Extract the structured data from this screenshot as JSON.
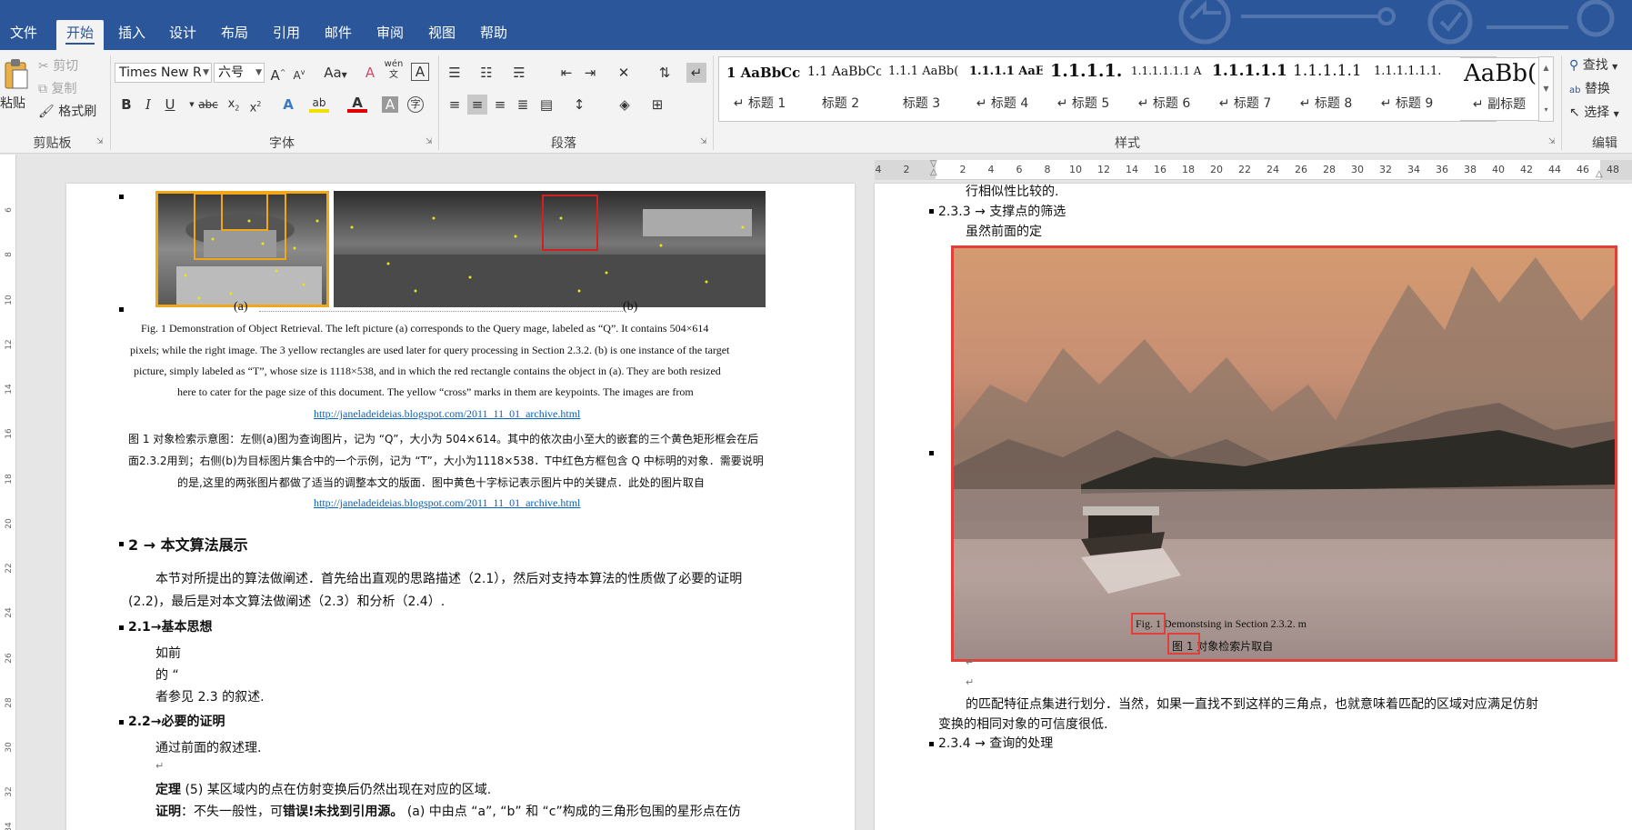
{
  "app": {
    "accent": "#2b579a",
    "tabs": [
      "文件",
      "开始",
      "插入",
      "设计",
      "布局",
      "引用",
      "邮件",
      "审阅",
      "视图",
      "帮助"
    ],
    "active_tab": "开始"
  },
  "ribbon": {
    "clipboard": {
      "label": "剪贴板",
      "paste": "粘贴",
      "cut": "剪切",
      "copy": "复制",
      "format_painter": "格式刷"
    },
    "font": {
      "label": "字体",
      "font_name": "Times New R",
      "font_size": "六号",
      "change_case": "Aa",
      "phonetic": "wén"
    },
    "paragraph": {
      "label": "段落"
    },
    "styles": {
      "label": "样式",
      "items": [
        {
          "sample": "1  AaBbCc",
          "name": "↵ 标题 1"
        },
        {
          "sample": "1.1  AaBbCc",
          "name": "标题 2"
        },
        {
          "sample": "1.1.1  AaBb(",
          "name": "标题 3"
        },
        {
          "sample": "1.1.1.1  AaE",
          "name": "↵ 标题 4"
        },
        {
          "sample": "1.1.1.1.",
          "name": "↵ 标题 5"
        },
        {
          "sample": "1.1.1.1.1.1  A",
          "name": "↵ 标题 6"
        },
        {
          "sample": "1.1.1.1.1.",
          "name": "↵ 标题 7"
        },
        {
          "sample": "1.1.1.1.1",
          "name": "↵ 标题 8"
        },
        {
          "sample": "1.1.1.1.1.1.",
          "name": "↵ 标题 9"
        },
        {
          "sample": "AaBb(",
          "name": "↵ 副标题"
        }
      ]
    },
    "editing": {
      "label": "编辑",
      "find": "查找",
      "replace": "替换",
      "select": "选择"
    }
  },
  "rulers": {
    "vertical_ticks": [
      "6",
      "8",
      "10",
      "12",
      "14",
      "16",
      "18",
      "20",
      "22",
      "24",
      "26",
      "28",
      "30",
      "32",
      "34"
    ],
    "horizontal_ticks": [
      "4",
      "2",
      "2",
      "4",
      "6",
      "8",
      "10",
      "12",
      "14",
      "16",
      "18",
      "20",
      "22",
      "24",
      "26",
      "28",
      "30",
      "32",
      "34",
      "36",
      "38",
      "40",
      "42",
      "44",
      "46",
      "48"
    ]
  },
  "left_page": {
    "caption_ab": {
      "a": "(a)",
      "b": "(b)"
    },
    "fig_caption_en": [
      "Fig. 1 Demonstration of Object Retrieval. The left picture (a) corresponds to the Query mage, labeled as “Q”.   It contains 504×614",
      "pixels; while the right image. The 3 yellow rectangles are used later for query processing in Section 2.3.2. (b) is one instance of the target",
      "picture, simply labeled as “T”, whose size is 1118×538, and in which the red rectangle contains the object in (a). They are both resized",
      "here to cater for the page size of this document. The yellow “cross” marks in them are keypoints. The images are from"
    ],
    "link1": "http://janeladeideias.blogspot.com/2011_11_01_archive.html",
    "fig_caption_cn": [
      "图 1  对象检索示意图：左侧(a)图为查询图片，记为 “Q”，大小为 504×614。其中的依次由小至大的嵌套的三个黄色矩形框会在后",
      "面2.3.2用到；右侧(b)为目标图片集合中的一个示例，记为 “T”，大小为1118×538．T中红色方框包含  Q  中标明的对象．需要说明",
      "的是,这里的两张图片都做了适当的调整本文的版面．图中黄色十字标记表示图片中的关键点．此处的图片取自"
    ],
    "link2": "http://janeladeideias.blogspot.com/2011_11_01_archive.html",
    "h2": "2 → 本文算法展示",
    "p2_lines": [
      "本节对所提出的算法做阐述．首先给出直观的思路描述（2.1），然后对支持本算法的性质做了必要的证明",
      "(2.2)，最后是对本文算法做阐述（2.3）和分析（2.4）."
    ],
    "h21": "2.1→基本思想",
    "p21_lines": [
      "如前",
      "的 “",
      "者参见 2.3 的叙述."
    ],
    "h22": "2.2→必要的证明",
    "p22_line1": "通过前面的叙述理.",
    "theorem_label": "定理",
    "theorem_text": "(5) 某区域内的点在仿射变换后仍然出现在对应的区域.",
    "proof_label": "证明",
    "proof_text1": "：不失一般性，可",
    "proof_error": "错误!未找到引用源。",
    "proof_text2": "(a) 中由点 “a”, “b” 和 “c”构成的三角形包围的星形点在仿"
  },
  "right_page": {
    "top_line": "行相似性比较的.",
    "h233": "2.3.3 → 支撑点的筛选",
    "p233": "虽然前面的定",
    "caption_en_fig": "Fig. 1",
    "caption_en_rest": "Demonstsing in Section 2.3.2. m",
    "caption_cn_fig": "图 1",
    "caption_cn_rest": "对象检索片取自",
    "p_match_l1": "的匹配特征点集进行划分．当然，如果一直找不到这样的三角点，也就意味着匹配的区域对应满足仿射",
    "p_match_l2": "变换的相同对象的可信度很低.",
    "h234": "2.3.4 → 查询的处理"
  }
}
